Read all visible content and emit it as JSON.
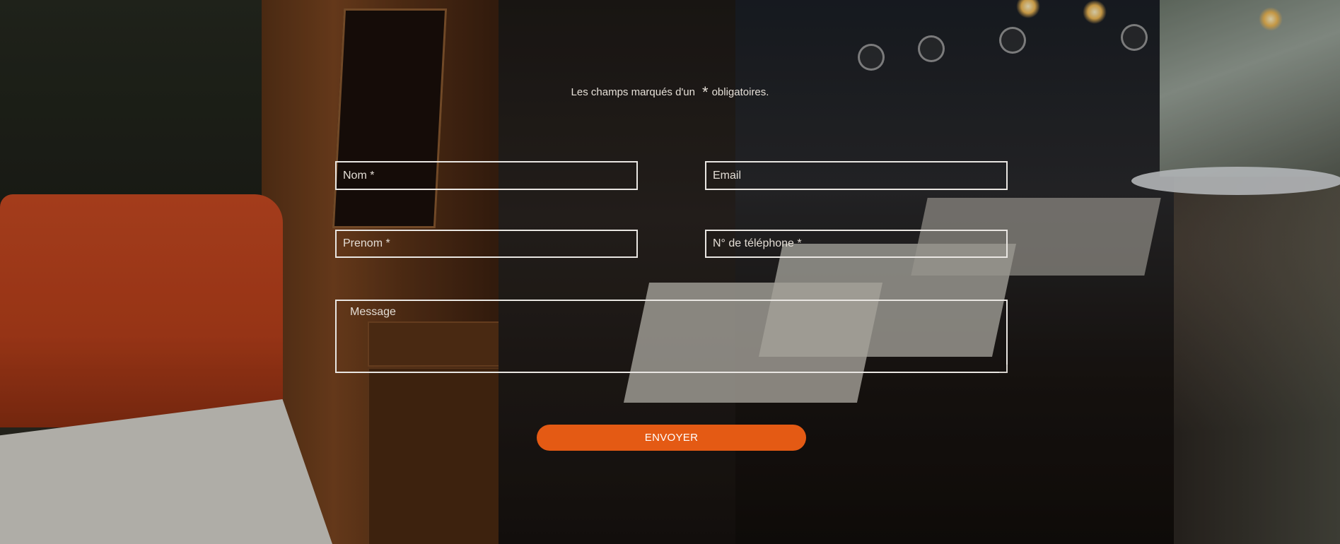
{
  "form": {
    "required_note_before": "Les champs marqués d'un",
    "required_note_star": "*",
    "required_note_after": "obligatoires.",
    "fields": {
      "nom": {
        "placeholder": "Nom *",
        "value": ""
      },
      "email": {
        "placeholder": "Email",
        "value": ""
      },
      "prenom": {
        "placeholder": "Prenom *",
        "value": ""
      },
      "telephone": {
        "placeholder": "N° de téléphone *",
        "value": ""
      },
      "message": {
        "placeholder": "Message",
        "value": ""
      }
    },
    "submit_label": "ENVOYER"
  },
  "colors": {
    "accent": "#e45a14",
    "field_border": "#e9e6e2",
    "text": "#e6e0d8"
  }
}
